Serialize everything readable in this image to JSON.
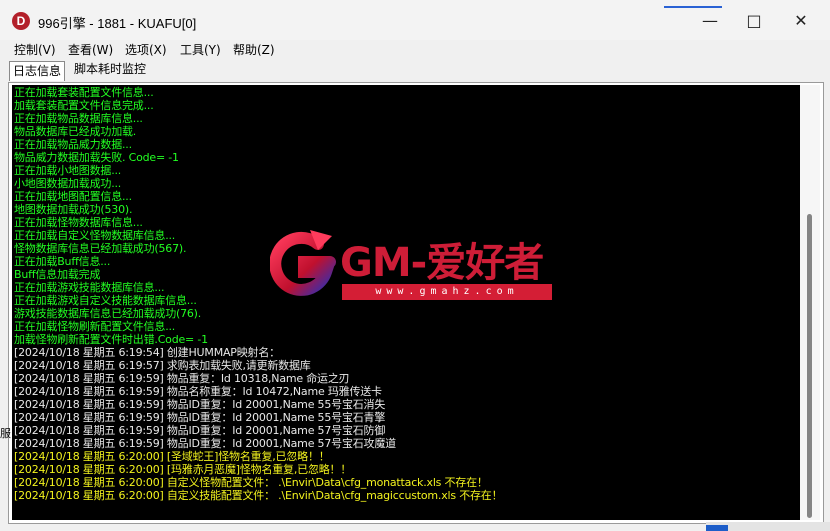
{
  "window": {
    "title": "996引擎 - 1881 - KUAFU[0]",
    "icon": "app-logo-icon"
  },
  "controls": {
    "minimize": "—",
    "maximize": "□",
    "close": "✕"
  },
  "menu": [
    "控制(V)",
    "查看(W)",
    "选项(X)",
    "工具(Y)",
    "帮助(Z)"
  ],
  "tabs": [
    "日志信息",
    "脚本耗时监控"
  ],
  "log": [
    {
      "text": "正在加载套装配置文件信息...",
      "color": "green"
    },
    {
      "text": "加载套装配置文件信息完成...",
      "color": "green"
    },
    {
      "text": "正在加载物品数据库信息...",
      "color": "green"
    },
    {
      "text": "物品数据库已经成功加载.",
      "color": "green"
    },
    {
      "text": "正在加载物品威力数据...",
      "color": "green"
    },
    {
      "text": "物品威力数据加载失败. Code= -1",
      "color": "green"
    },
    {
      "text": "正在加载小地图数据...",
      "color": "green"
    },
    {
      "text": "小地图数据加载成功...",
      "color": "green"
    },
    {
      "text": "正在加载地图配置信息...",
      "color": "green"
    },
    {
      "text": "地图数据加载成功(530).",
      "color": "green"
    },
    {
      "text": "正在加载怪物数据库信息...",
      "color": "green"
    },
    {
      "text": "正在加载自定义怪物数据库信息...",
      "color": "green"
    },
    {
      "text": "怪物数据库信息已经加载成功(567).",
      "color": "green"
    },
    {
      "text": "正在加载Buff信息...",
      "color": "green"
    },
    {
      "text": "Buff信息加载完成",
      "color": "green"
    },
    {
      "text": "正在加载游戏技能数据库信息...",
      "color": "green"
    },
    {
      "text": "正在加载游戏自定义技能数据库信息...",
      "color": "green"
    },
    {
      "text": "游戏技能数据库信息已经加载成功(76).",
      "color": "green"
    },
    {
      "text": "正在加载怪物刷新配置文件信息...",
      "color": "green"
    },
    {
      "text": "加载怪物刷新配置文件时出错.Code= -1",
      "color": "green"
    },
    {
      "text": "[2024/10/18 星期五 6:19:54] 创建HUMMAP映射名：",
      "color": "white"
    },
    {
      "text": "[2024/10/18 星期五 6:19:57] 求购表加载失败,请更新数据库",
      "color": "white"
    },
    {
      "text": "[2024/10/18 星期五 6:19:59] 物品重复：Id 10318,Name 命运之刃",
      "color": "white"
    },
    {
      "text": "[2024/10/18 星期五 6:19:59] 物品名称重复：Id 10472,Name 玛雅传送卡",
      "color": "white"
    },
    {
      "text": "[2024/10/18 星期五 6:19:59] 物品ID重复：Id 20001,Name 55号宝石消失",
      "color": "white"
    },
    {
      "text": "[2024/10/18 星期五 6:19:59] 物品ID重复：Id 20001,Name 55号宝石青擎",
      "color": "white"
    },
    {
      "text": "[2024/10/18 星期五 6:19:59] 物品ID重复：Id 20001,Name 57号宝石防御",
      "color": "white"
    },
    {
      "text": "[2024/10/18 星期五 6:19:59] 物品ID重复：Id 20001,Name 57号宝石攻魔道",
      "color": "white"
    },
    {
      "text": "[2024/10/18 星期五 6:20:00] [圣域蛇王]怪物名重复,已忽略！！",
      "color": "yellow"
    },
    {
      "text": "[2024/10/18 星期五 6:20:00] [玛雅赤月恶魔]怪物名重复,已忽略！！",
      "color": "yellow"
    },
    {
      "text": "[2024/10/18 星期五 6:20:00] 自定义怪物配置文件： .\\Envir\\Data\\cfg_monattack.xls 不存在！",
      "color": "yellow"
    },
    {
      "text": "[2024/10/18 星期五 6:20:00] 自定义技能配置文件： .\\Envir\\Data\\cfg_magiccustom.xls 不存在！",
      "color": "yellow"
    }
  ],
  "watermark": {
    "brand": "GM-爱好者",
    "url": "www.gmahz.com"
  },
  "edge_text": "服",
  "colors": {
    "green": "#22ff22",
    "white": "#e8e8e8",
    "yellow": "#f2f21e",
    "console_bg": "#000000",
    "brand": "#e0203c"
  }
}
